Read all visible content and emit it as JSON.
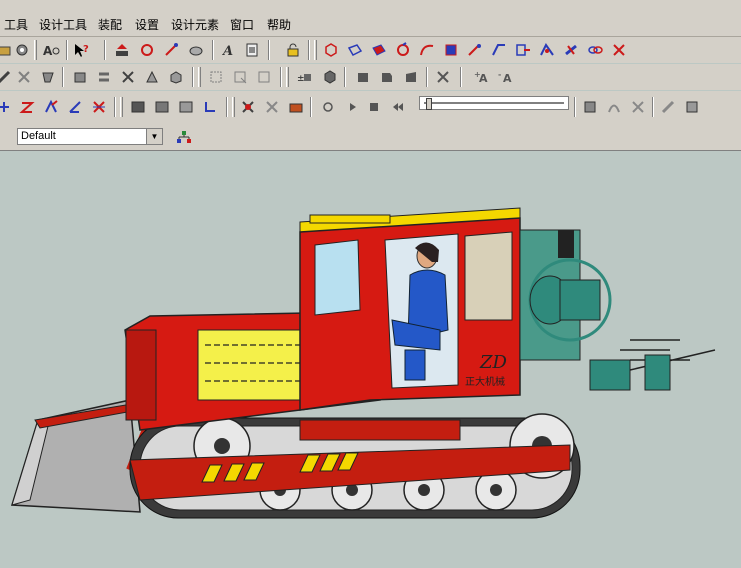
{
  "menubar": {
    "items": [
      "工具",
      "设计工具",
      "装配",
      "设置",
      "设计元素",
      "窗口",
      "帮助"
    ]
  },
  "stylebar": {
    "style_value": "Default"
  },
  "scene": {
    "company_label": "正大机械",
    "logo_text": "ZD"
  },
  "colors": {
    "toolbar_bg": "#d4d0c8",
    "viewport_bg": "#bcc8c4",
    "tractor_red": "#d61a12",
    "panel_yellow": "#f4f04a",
    "machine_teal": "#2f8a7c",
    "icon_red": "#cc1a1a",
    "icon_blue": "#2a3bb8",
    "icon_dark": "#404040"
  },
  "icons": {
    "row1": [
      "folder-icon",
      "gear-icon",
      "find-icon",
      "help-pointer-icon",
      "upload-icon",
      "rotate-icon",
      "sketch-icon",
      "measure-icon",
      "text-icon",
      "document-icon",
      "lock-icon",
      "cube-view-icon",
      "cube-edge-icon",
      "cube-face-icon",
      "rotate-view-icon",
      "curve-icon",
      "pan-icon",
      "orbit-icon",
      "draw-icon",
      "export-icon",
      "mirror-icon",
      "link-icon",
      "tools-icon"
    ],
    "row2": [
      "tool-icon",
      "tool-icon",
      "tool-icon",
      "part-icon",
      "link-icon",
      "transform-icon",
      "shape-icon",
      "shape-icon",
      "rect-select-icon",
      "rect-select-icon",
      "rect-select-icon",
      "add-icon",
      "mesh-icon",
      "face-icon",
      "face-icon",
      "face-icon",
      "face-icon",
      "settings-icon",
      "font-size-icon",
      "font-size-icon"
    ],
    "row3": [
      "move-icon",
      "scale-icon",
      "rotate-icon",
      "axis-icon",
      "delete-icon",
      "frame-icon",
      "frame-icon",
      "frame-icon",
      "corner-icon",
      "select-icon",
      "tool-icon",
      "camera-icon",
      "record-icon",
      "play-icon",
      "stop-icon",
      "rewind-icon",
      "film-icon",
      "motion-icon",
      "path-icon",
      "tool-icon",
      "render-icon"
    ]
  }
}
